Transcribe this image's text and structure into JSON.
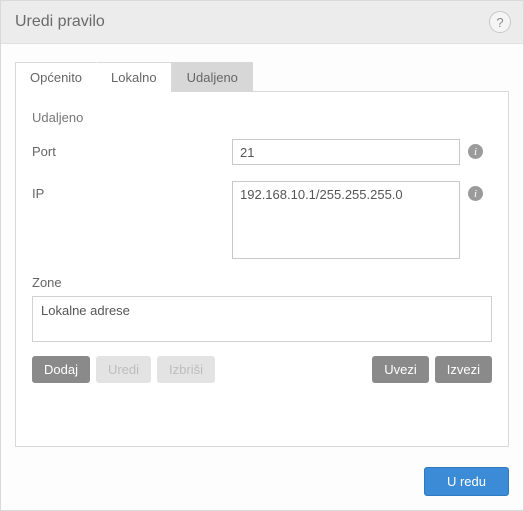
{
  "window": {
    "title": "Uredi pravilo"
  },
  "tabs": {
    "general": "Općenito",
    "local": "Lokalno",
    "remote": "Udaljeno"
  },
  "remote_panel": {
    "heading": "Udaljeno",
    "port_label": "Port",
    "port_value": "21",
    "ip_label": "IP",
    "ip_value": "192.168.10.1/255.255.255.0",
    "zone_label": "Zone",
    "zone_items": [
      "Lokalne adrese"
    ],
    "buttons": {
      "add": "Dodaj",
      "edit": "Uredi",
      "delete": "Izbriši",
      "import": "Uvezi",
      "export": "Izvezi"
    }
  },
  "footer": {
    "ok": "U redu"
  }
}
